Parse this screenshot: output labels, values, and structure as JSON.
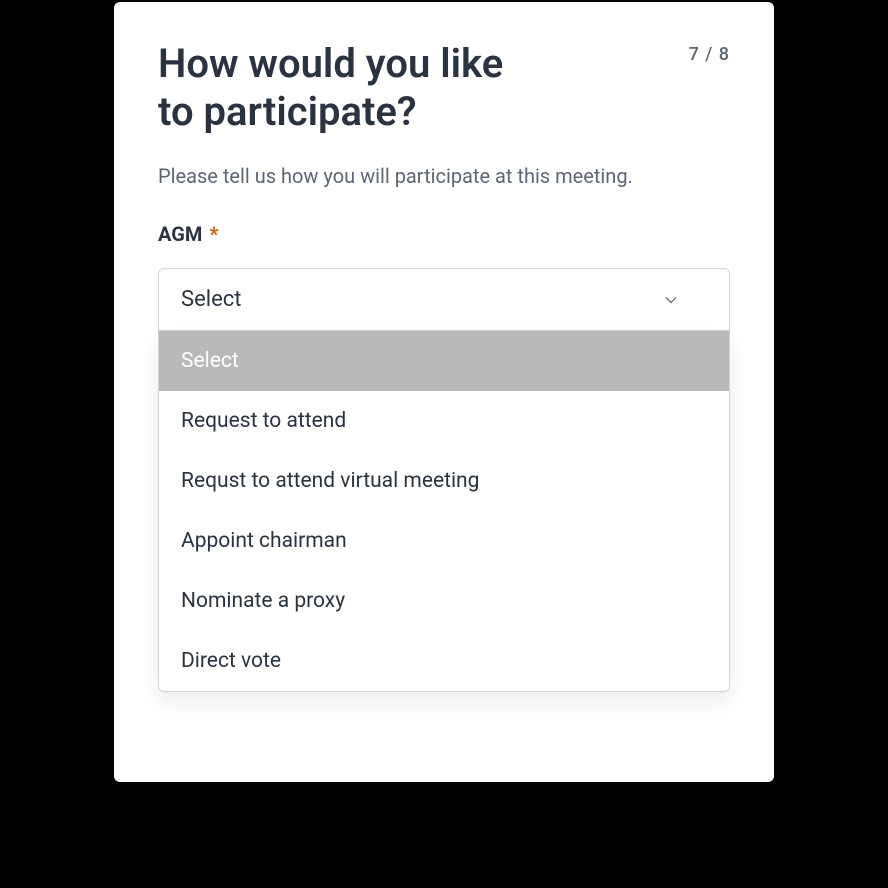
{
  "header": {
    "title": "How would you like\nto participate?",
    "step": "7 / 8"
  },
  "subtitle": "Please tell us how you will participate at this meeting.",
  "field": {
    "label": "AGM",
    "required_marker": "*"
  },
  "select": {
    "current_value": "Select",
    "options": [
      "Select",
      "Request to attend",
      "Requst to attend virtual meeting",
      "Appoint chairman",
      "Nominate a proxy",
      "Direct vote"
    ],
    "highlighted_index": 0
  }
}
